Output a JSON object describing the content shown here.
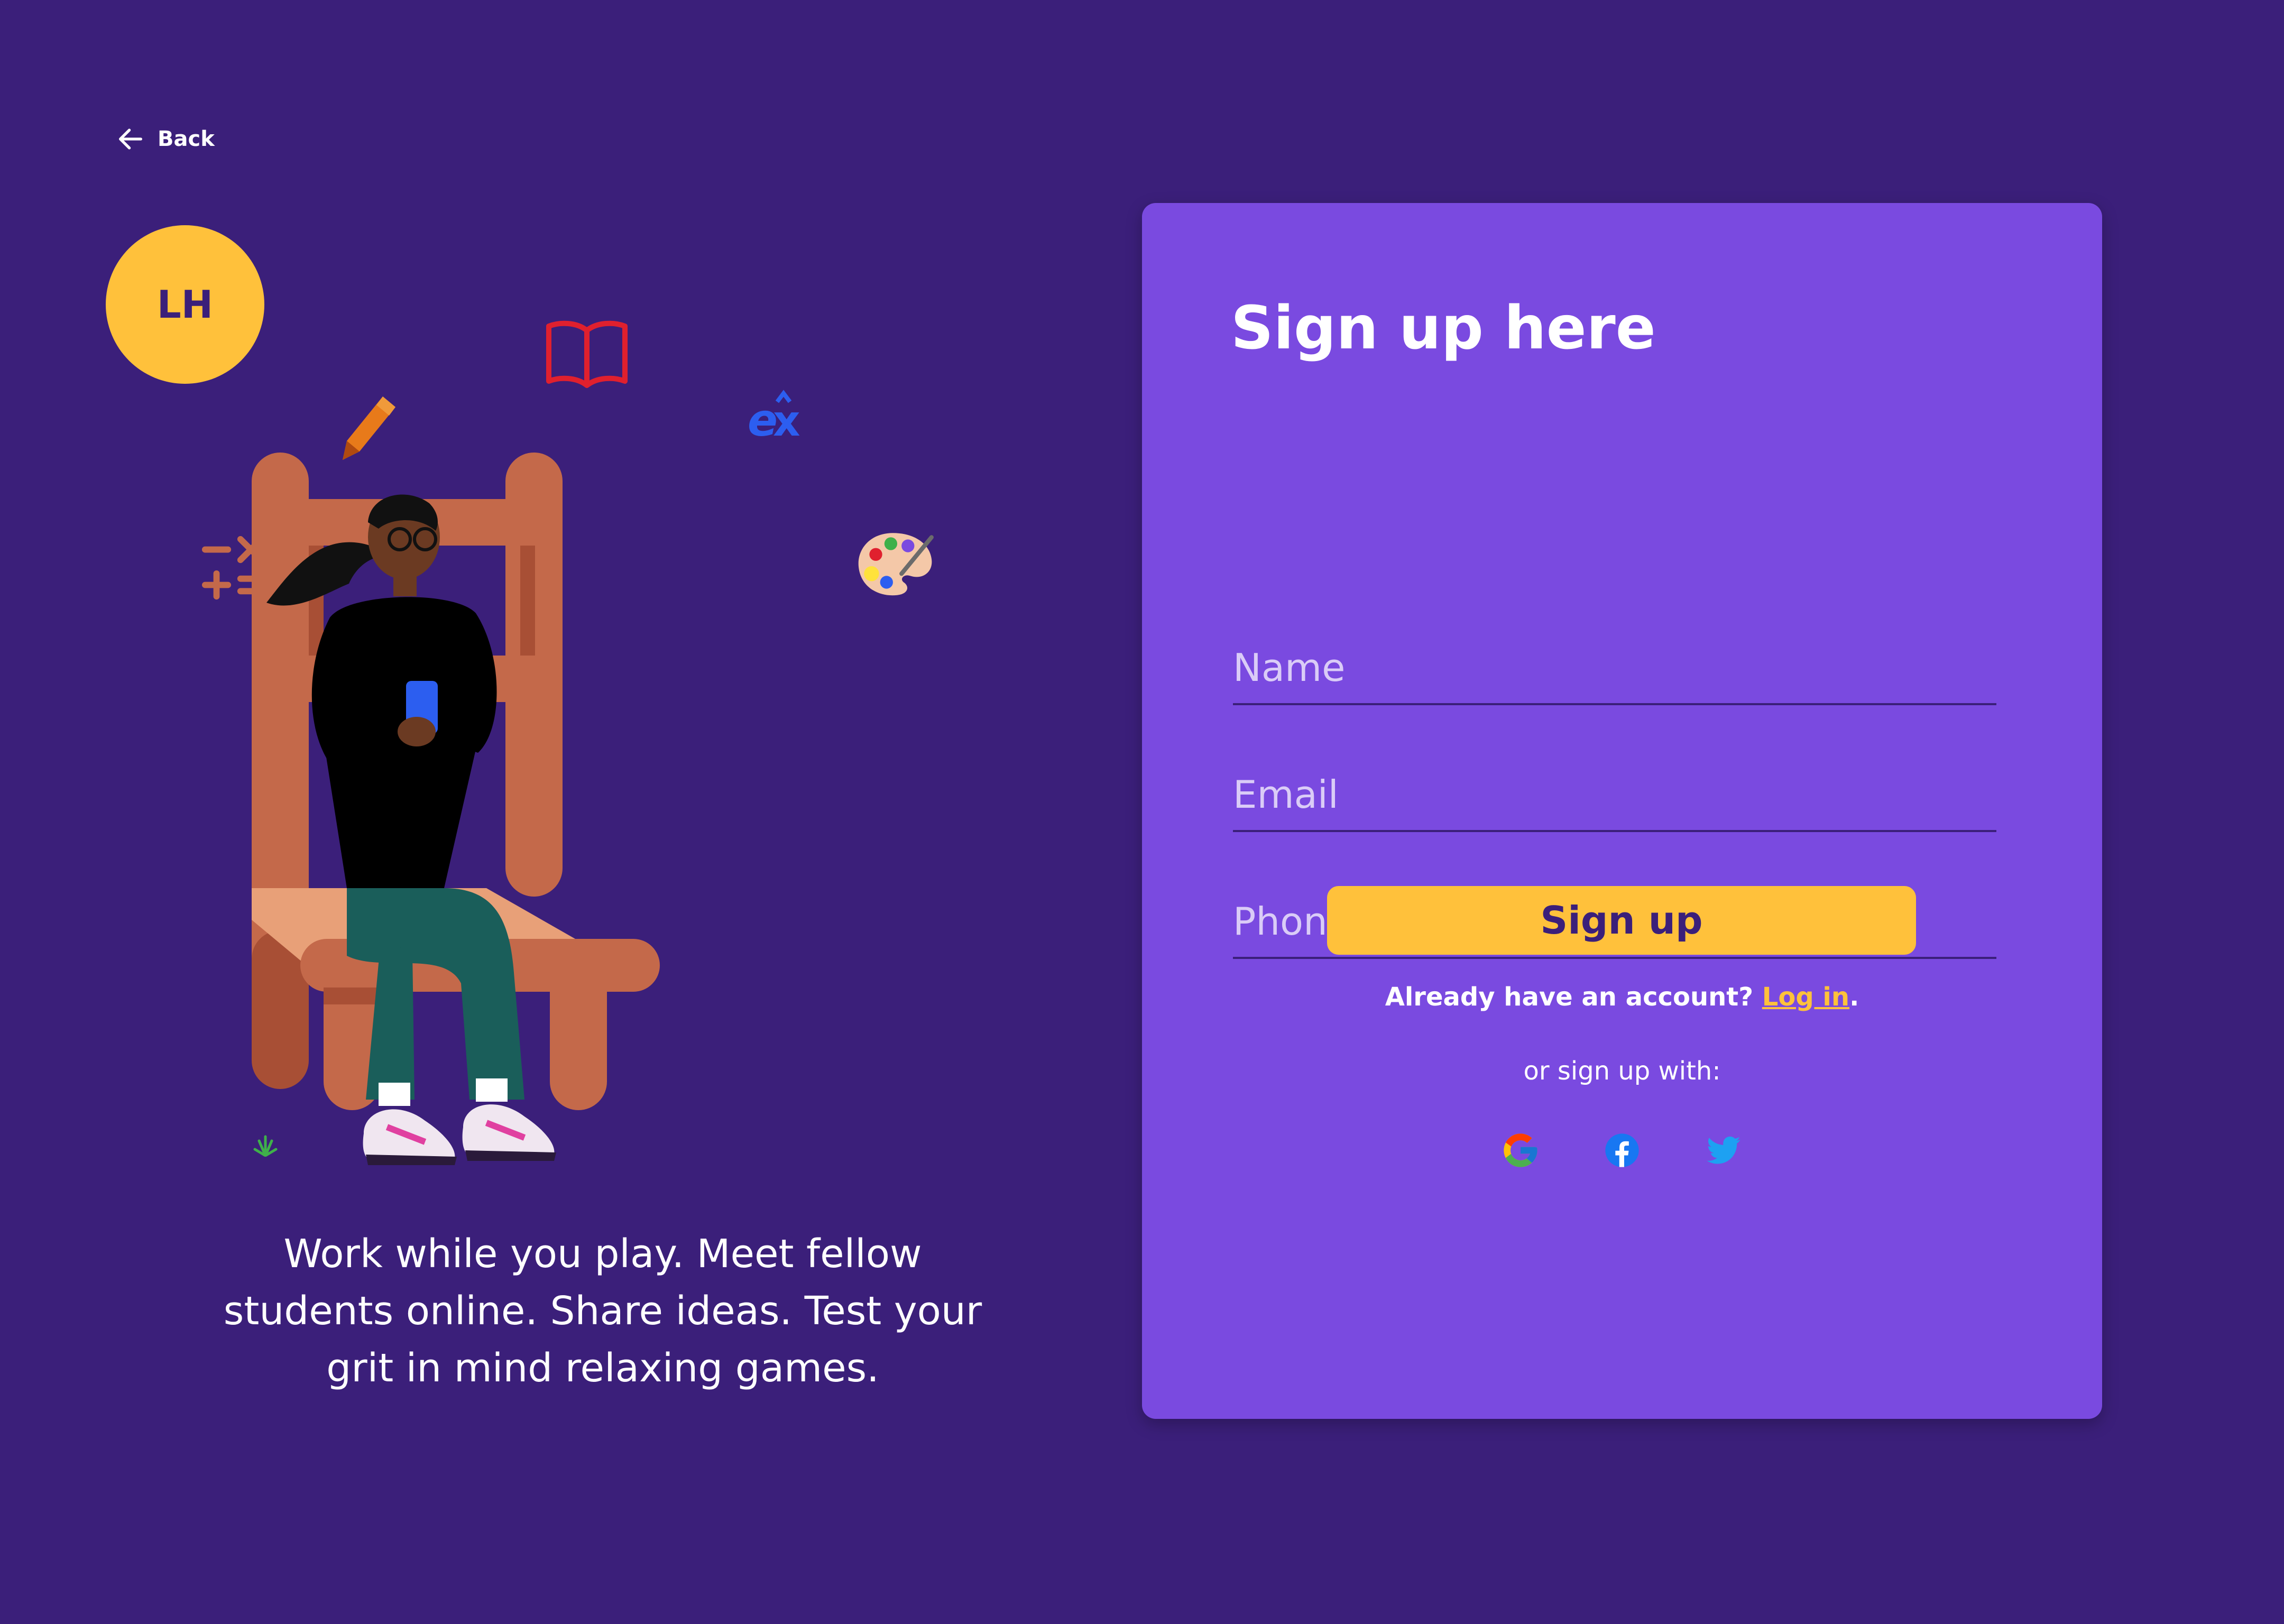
{
  "nav": {
    "back_label": "Back"
  },
  "logo": {
    "initials": "LH"
  },
  "tagline": "Work while you play. Meet fellow students online. Share ideas. Test your grit in mind relaxing games.",
  "form": {
    "title": "Sign up here",
    "fields": {
      "name": {
        "placeholder": "Name",
        "value": ""
      },
      "email": {
        "placeholder": "Email",
        "value": ""
      },
      "phone": {
        "placeholder": "Phone",
        "value": ""
      }
    },
    "submit_label": "Sign up",
    "account_prompt": "Already have an account?",
    "login_link": "Log in",
    "account_suffix": ".",
    "social_prompt": "or sign up with:",
    "social": [
      "google-icon",
      "facebook-icon",
      "twitter-icon"
    ]
  },
  "colors": {
    "background": "#3b1f7a",
    "card": "#7a4ae0",
    "accent": "#ffc13b",
    "text": "#ffffff"
  }
}
